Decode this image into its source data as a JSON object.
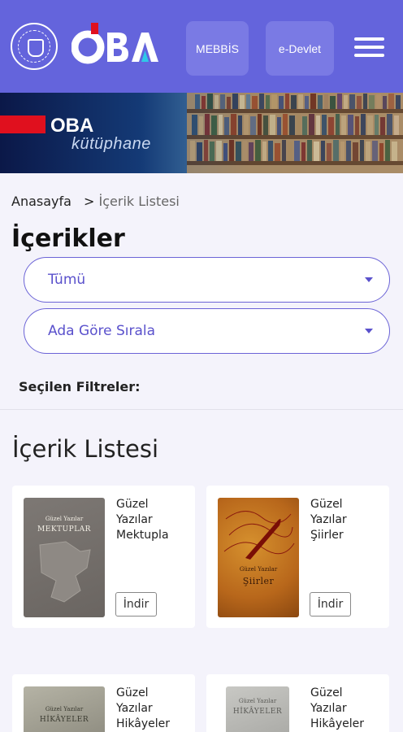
{
  "header": {
    "logo_text": "OBA",
    "mebbis_label": "MEBBİS",
    "edevlet_label": "e-Devlet"
  },
  "banner": {
    "brand": "OBA",
    "subtitle": "kütüphane"
  },
  "breadcrumb": {
    "home": "Anasayfa",
    "separator": ">",
    "current": "İçerik Listesi"
  },
  "page_title": "İçerikler",
  "filters": {
    "category_select": "Tümü",
    "sort_select": "Ada Göre Sırala",
    "selected_label": "Seçilen Filtreler:"
  },
  "section_title": "İçerik Listesi",
  "cards": [
    {
      "title": "Güzel\nYazılar\nMektupla",
      "cover_small": "Güzel Yazılar",
      "cover_big": "MEKTUPLAR",
      "download": "İndir"
    },
    {
      "title": "Güzel\nYazılar\nŞiirler",
      "cover_small": "Güzel Yazılar",
      "cover_big": "Şiirler",
      "download": "İndir"
    },
    {
      "title": "Güzel\nYazılar\nHikâyeler",
      "cover_small": "Güzel Yazılar",
      "cover_big": "HİKÂYELER"
    },
    {
      "title": "Güzel\nYazılar\nHikâyeler",
      "cover_small": "Güzel Yazılar",
      "cover_big": "HİKÂYELER"
    }
  ],
  "colors": {
    "header_bg": "#6464dc",
    "accent": "#5a51cc",
    "page_bg": "#f4f3fb"
  }
}
